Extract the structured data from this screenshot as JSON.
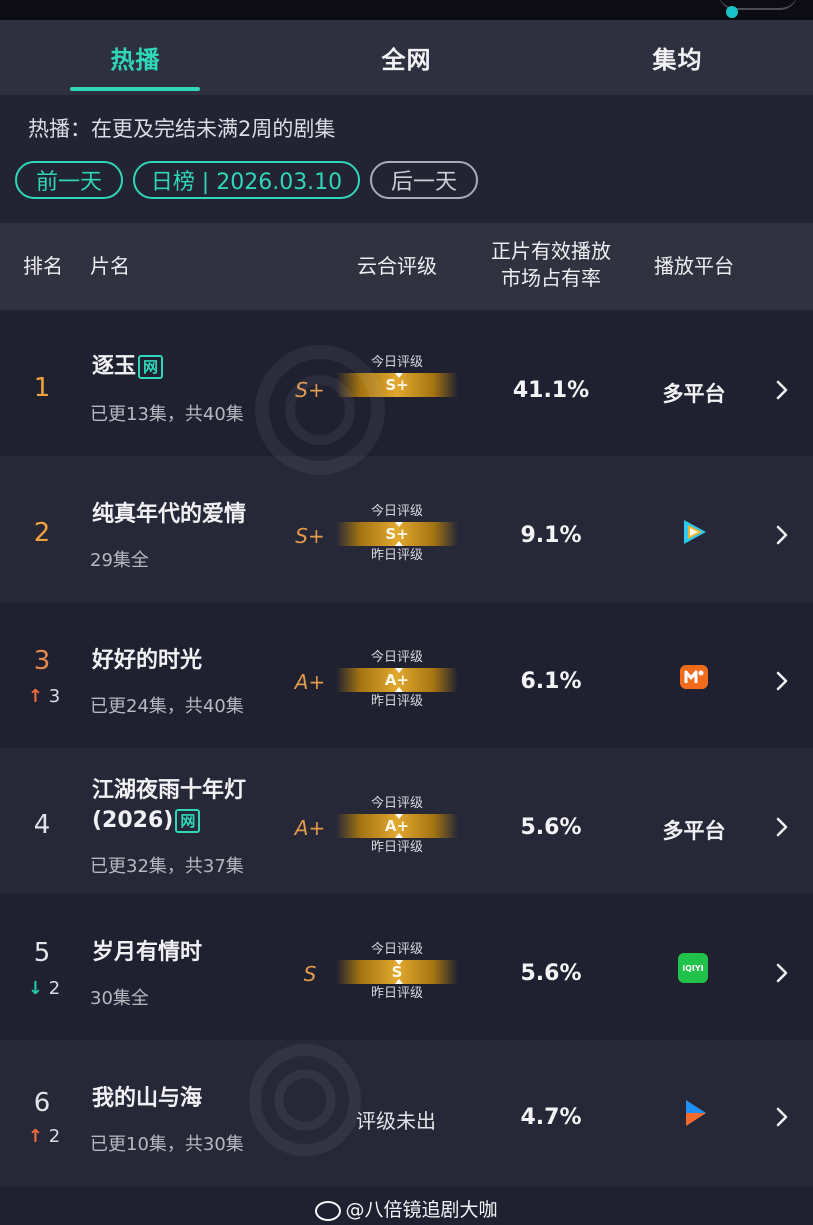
{
  "tabs": [
    {
      "label": "热播",
      "active": true
    },
    {
      "label": "全网",
      "active": false
    },
    {
      "label": "集均",
      "active": false
    }
  ],
  "filter": {
    "description": "热播：在更及完结未满2周的剧集",
    "prev_day": "前一天",
    "current": "日榜 | 2026.03.10",
    "next_day": "后一天"
  },
  "columns": {
    "rank": "排名",
    "title": "片名",
    "rating": "云合评级",
    "share_line1": "正片有效播放",
    "share_line2": "市场占有率",
    "platform": "播放平台"
  },
  "gauge_labels": {
    "today": "今日评级",
    "yesterday": "昨日评级"
  },
  "rows": [
    {
      "rank": "1",
      "title": "逐玉",
      "tag": "网",
      "episodes": "已更13集，共40集",
      "grade": "S+",
      "gauge_grade": "S+",
      "show_yesterday": false,
      "share": "41.1%",
      "platform_text": "多平台",
      "platform_icon": null,
      "trend": null
    },
    {
      "rank": "2",
      "title": "纯真年代的爱情",
      "tag": null,
      "episodes": "29集全",
      "grade": "S+",
      "gauge_grade": "S+",
      "show_yesterday": true,
      "share": "9.1%",
      "platform_text": null,
      "platform_icon": "tencent-video-icon",
      "trend": null
    },
    {
      "rank": "3",
      "title": "好好的时光",
      "tag": null,
      "episodes": "已更24集，共40集",
      "grade": "A+",
      "gauge_grade": "A+",
      "show_yesterday": true,
      "share": "6.1%",
      "platform_text": null,
      "platform_icon": "mango-tv-icon",
      "trend": {
        "dir": "up",
        "value": "3"
      }
    },
    {
      "rank": "4",
      "title": "江湖夜雨十年灯 (2026)",
      "tag": "网",
      "episodes": "已更32集，共37集",
      "grade": "A+",
      "gauge_grade": "A+",
      "show_yesterday": true,
      "share": "5.6%",
      "platform_text": "多平台",
      "platform_icon": null,
      "trend": null
    },
    {
      "rank": "5",
      "title": "岁月有情时",
      "tag": null,
      "episodes": "30集全",
      "grade": "S",
      "gauge_grade": "S",
      "show_yesterday": true,
      "share": "5.6%",
      "platform_text": null,
      "platform_icon": "iqiyi-icon",
      "trend": {
        "dir": "down",
        "value": "2"
      }
    },
    {
      "rank": "6",
      "title": "我的山与海",
      "tag": null,
      "episodes": "已更10集，共30集",
      "grade": null,
      "no_grade": "评级未出",
      "share": "4.7%",
      "platform_text": null,
      "platform_icon": "youku-icon",
      "trend": {
        "dir": "up",
        "value": "2"
      }
    }
  ],
  "iqiyi_text": "iQIYI",
  "colors": {
    "accent": "#2fd6b8",
    "up": "#f06a3f",
    "down": "#22c7a6",
    "gold": "#e2a92f"
  },
  "footer": {
    "text": "@八倍镜追剧大咖"
  }
}
